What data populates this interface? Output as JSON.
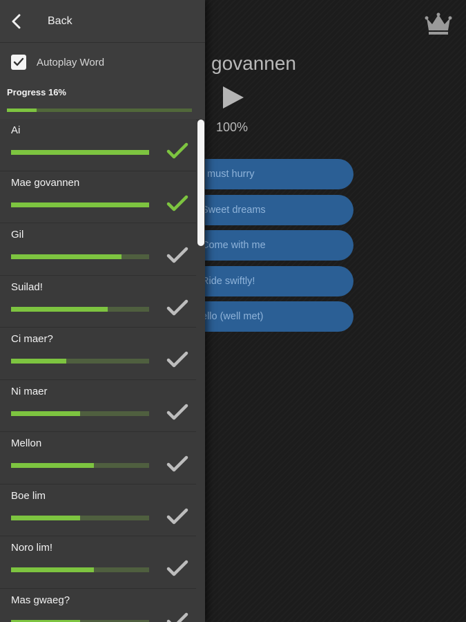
{
  "main": {
    "word": "govannen",
    "play_percent": "100%",
    "answers": [
      "I must hurry",
      "Sweet dreams",
      "Come with me",
      "Ride swiftly!",
      "ello (well met)"
    ],
    "crown_icon": "crown-icon"
  },
  "drawer": {
    "back_label": "Back",
    "autoplay_label": "Autoplay Word",
    "autoplay_checked": true,
    "progress_label": "Progress 16%",
    "progress_fraction": 0.16,
    "colors": {
      "accent": "#7dc440",
      "check_done": "#7dc440",
      "check_pending": "#bdbdbd",
      "answer_bg": "#2b5f95"
    },
    "items": [
      {
        "label": "Ai",
        "progress": 1.0,
        "done": true
      },
      {
        "label": "Mae govannen",
        "progress": 1.0,
        "done": true
      },
      {
        "label": "Gil",
        "progress": 0.8,
        "done": false
      },
      {
        "label": "Suilad!",
        "progress": 0.7,
        "done": false
      },
      {
        "label": "Ci maer?",
        "progress": 0.4,
        "done": false
      },
      {
        "label": "Ni maer",
        "progress": 0.5,
        "done": false
      },
      {
        "label": "Mellon",
        "progress": 0.6,
        "done": false
      },
      {
        "label": "Boe lim",
        "progress": 0.5,
        "done": false
      },
      {
        "label": "Noro lim!",
        "progress": 0.6,
        "done": false
      },
      {
        "label": "Mas gwaeg?",
        "progress": 0.5,
        "done": false
      }
    ]
  }
}
